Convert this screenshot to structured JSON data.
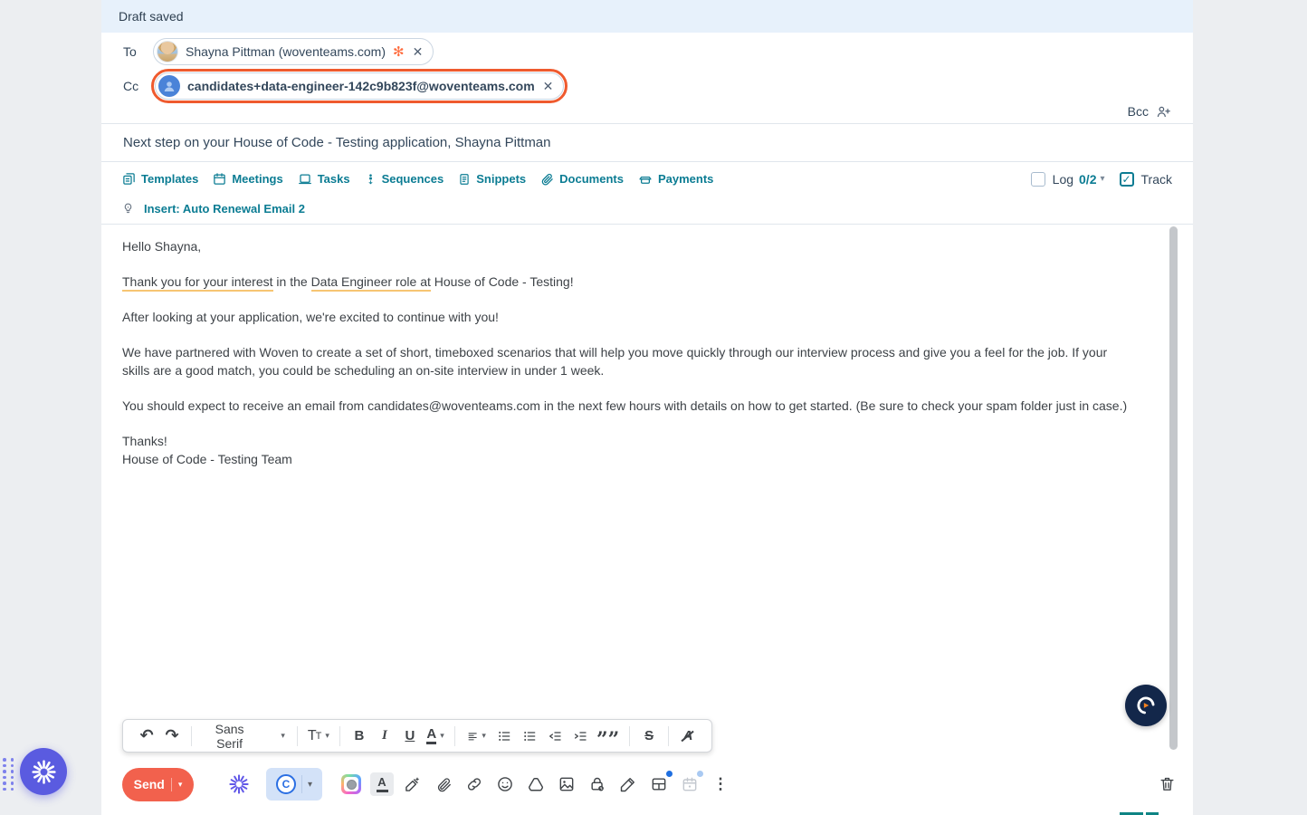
{
  "draft_bar": {
    "text": "Draft saved"
  },
  "recipients": {
    "to_label": "To",
    "to_chip": "Shayna Pittman (woventeams.com)",
    "cc_label": "Cc",
    "cc_chip": "candidates+data-engineer-142c9b823f@woventeams.com",
    "bcc_label": "Bcc"
  },
  "subject": {
    "value": "Next step on your House of Code - Testing application, Shayna Pittman"
  },
  "actions_bar": {
    "items": [
      "Templates",
      "Meetings",
      "Tasks",
      "Sequences",
      "Snippets",
      "Documents",
      "Payments"
    ],
    "log_label": "Log",
    "log_count": "0/2",
    "track_label": "Track",
    "insert_link": "Insert: Auto Renewal Email 2"
  },
  "email_body": {
    "greeting": "Hello Shayna,",
    "p2_u1": "Thank you for your interest",
    "p2_mid": " in the ",
    "p2_u2": "Data Engineer role at",
    "p2_end": " House of Code - Testing!",
    "p3": "After looking at your application, we're excited to continue with you!",
    "p4": "We have partnered with Woven to create a set of short, timeboxed scenarios that will help you move quickly through our interview process and give you a feel for the job. If your skills are a good match, you could be scheduling an on-site interview in under 1 week.",
    "p5": "You should expect to receive an email from candidates@woventeams.com in the next few hours with details on how to get started. (Be sure to check your spam folder just in case.)",
    "closing1": "Thanks!",
    "closing2": "House of Code - Testing Team"
  },
  "format_toolbar": {
    "font_name": "Sans Serif",
    "size_big": "T",
    "size_small": "T",
    "bold": "B",
    "italic": "I",
    "underline": "U",
    "color_letter": "A",
    "quote": "””",
    "strike": "S",
    "clear_letter": "A"
  },
  "send_row": {
    "send_label": "Send",
    "c_logo_letter": "C"
  },
  "icons": {
    "undo": "↶",
    "redo": "↷",
    "caret": "▾",
    "close": "✕",
    "sprocket": "✻",
    "check": "✓",
    "more": "⋮"
  },
  "colors": {
    "accent_teal": "#0b7c93",
    "send_orange": "#f2614d",
    "focus_ring_orange": "#ef5a2e",
    "brand_purple": "#5a5be0",
    "link_blue": "#2b6fe3",
    "draft_bar_blue": "#e7f1fb",
    "underline_warn": "#f7c573",
    "navy_button": "#13274a"
  }
}
